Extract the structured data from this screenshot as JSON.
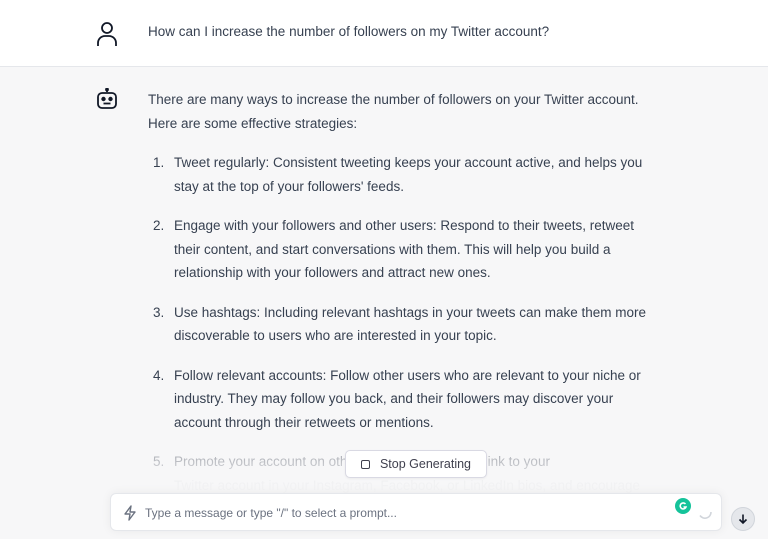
{
  "user_message": {
    "avatar_icon": "user-icon",
    "text": "How can I increase the number of followers on my Twitter account?"
  },
  "assistant_message": {
    "avatar_icon": "robot-icon",
    "intro_line1": "There are many ways to increase the number of followers on your Twitter account.",
    "intro_line2": "Here are some effective strategies:",
    "items": [
      {
        "number": "1.",
        "lines": [
          "Tweet regularly: Consistent tweeting keeps your account active, and helps you",
          "stay at the top of your followers' feeds."
        ]
      },
      {
        "number": "2.",
        "lines": [
          "Engage with your followers and other users: Respond to their tweets, retweet",
          "their content, and start conversations with them. This will help you build a",
          "relationship with your followers and attract new ones."
        ]
      },
      {
        "number": "3.",
        "lines": [
          "Use hashtags: Including relevant hashtags in your tweets can make them more",
          "discoverable to users who are interested in your topic."
        ]
      },
      {
        "number": "4.",
        "lines": [
          "Follow relevant accounts: Follow other users who are relevant to your niche or",
          "industry. They may follow you back, and their followers may discover your",
          "account through their retweets or mentions."
        ]
      },
      {
        "number": "5.",
        "lines": [
          "Promote your account on other platforms: Include a link to your",
          "Twitter account in your Instagram, Facebook, or LinkedIn bios, and encourage"
        ]
      }
    ]
  },
  "stop_button": {
    "label": "Stop Generating"
  },
  "composer": {
    "placeholder": "Type a message or type \"/\" to select a prompt...",
    "value": ""
  },
  "colors": {
    "background": "#f7f7f8",
    "user_row": "#ffffff",
    "text": "#374151",
    "grammarly": "#15c39a"
  }
}
